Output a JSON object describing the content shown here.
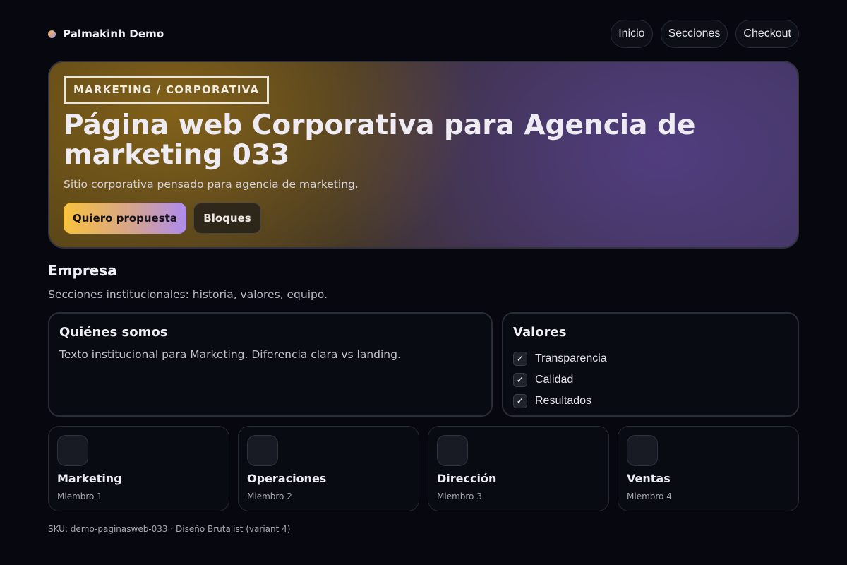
{
  "brand": {
    "name": "Palmakinh Demo"
  },
  "nav": {
    "items": [
      "Inicio",
      "Secciones",
      "Checkout"
    ]
  },
  "hero": {
    "tag": "MARKETING / CORPORATIVA",
    "title": "Página web Corporativa para Agencia de marketing 033",
    "subtitle": "Sitio corporativa pensado para agencia de marketing.",
    "primary_button": "Quiero propuesta",
    "secondary_button": "Bloques"
  },
  "section": {
    "title": "Empresa",
    "subtitle": "Secciones institucionales: historia, valores, equipo."
  },
  "about": {
    "title": "Quiénes somos",
    "text": "Texto institucional para Marketing. Diferencia clara vs landing."
  },
  "values": {
    "title": "Valores",
    "check_icon": "✓",
    "items": [
      "Transparencia",
      "Calidad",
      "Resultados"
    ]
  },
  "team": [
    {
      "name": "Marketing",
      "role": "Miembro 1"
    },
    {
      "name": "Operaciones",
      "role": "Miembro 2"
    },
    {
      "name": "Dirección",
      "role": "Miembro 3"
    },
    {
      "name": "Ventas",
      "role": "Miembro 4"
    }
  ],
  "footer": {
    "text": "SKU: demo-paginasweb-033 · Diseño Brutalist (variant 4)"
  },
  "colors": {
    "background": "#07080f",
    "accent_gold": "#f8c23c",
    "accent_purple": "#ae8cee"
  }
}
